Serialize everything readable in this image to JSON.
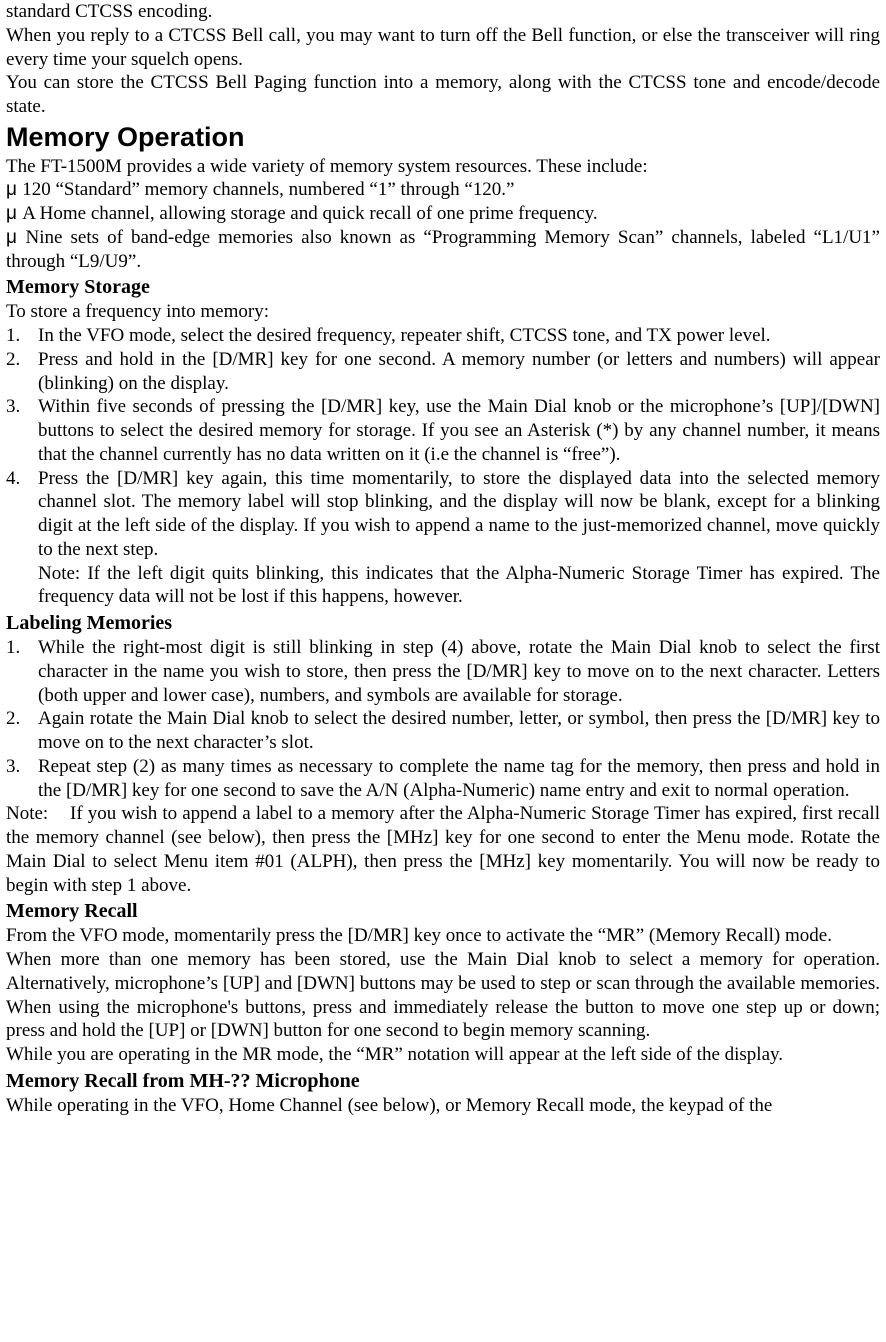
{
  "intro": {
    "p1": "standard CTCSS encoding.",
    "p2": "When you reply to a CTCSS Bell call, you may want to turn off the Bell function, or else the transceiver will ring every time your squelch opens.",
    "p3": "You can store the CTCSS Bell Paging function into a memory, along with the CTCSS tone and encode/decode state."
  },
  "memory_operation": {
    "heading": "Memory Operation",
    "intro": "The FT-1500M provides a wide variety of memory system resources. These include:",
    "bullets": {
      "b1": "120 “Standard” memory channels, numbered “1” through “120.”",
      "b2": "A Home channel, allowing storage and quick recall of one prime frequency.",
      "b3": "Nine sets of band-edge memories also known as “Programming Memory Scan” channels, labeled “L1/U1” through “L9/U9”."
    }
  },
  "memory_storage": {
    "heading": "Memory Storage",
    "intro": "To store a frequency into memory:",
    "items": {
      "i1": "In the VFO mode, select the desired frequency, repeater shift, CTCSS tone, and TX power level.",
      "i2": "Press and hold in the [D/MR] key for one second. A memory number (or letters and numbers) will appear (blinking) on the display.",
      "i3": "Within five seconds of pressing the [D/MR] key, use the Main Dial knob or the microphone’s [UP]/[DWN] buttons to select the desired memory for storage. If you see an Asterisk (*) by any channel number, it means that the channel currently has no data written on it (i.e the channel is “free”).",
      "i4": "Press the [D/MR] key again, this time momentarily, to store the displayed data into the selected memory channel slot. The memory label will stop blinking, and the display will now be blank, except for a blinking digit at the left side of the display. If you wish to append a name to the just-memorized channel, move quickly to the next step.",
      "note": "Note: If the left digit quits blinking, this indicates that the Alpha-Numeric Storage Timer has expired. The frequency data will not be lost if this happens, however."
    }
  },
  "labeling_memories": {
    "heading": "Labeling Memories",
    "items": {
      "i1": "While the right-most digit is still blinking in step (4) above, rotate the Main Dial knob to select the first character in the name you wish to store, then press the [D/MR] key to move on to the next character. Letters (both upper and lower case), numbers, and symbols are available for storage.",
      "i2": "Again rotate the Main Dial knob to select the desired number, letter, or symbol, then press the [D/MR] key to move on to the next character’s slot.",
      "i3": "Repeat step (2) as many times as necessary to complete the name tag for the memory, then press and hold in the [D/MR] key for one second to save the A/N (Alpha-Numeric) name entry and exit to normal operation."
    },
    "note_label": "Note:",
    "note": "If you wish to append a label to a memory after the Alpha-Numeric Storage Timer has expired, first recall the memory channel (see below), then press the [MHz] key for one second to enter the Menu mode. Rotate the Main Dial to select Menu item #01 (ALPH), then press the [MHz] key momentarily. You will now be ready to begin with step 1 above."
  },
  "memory_recall": {
    "heading": "Memory Recall",
    "p1": "From the VFO mode, momentarily press the [D/MR] key once to activate the “MR” (Memory Recall) mode.",
    "p2": "When more than one memory has been stored, use the Main Dial knob to select a memory for operation. Alternatively, microphone’s [UP] and [DWN] buttons may be used to step or scan through the available memories. When using the microphone's buttons, press and immediately release the button to move one step up or down; press and hold the [UP] or [DWN] button for one second to begin memory scanning.",
    "p3": "While you are operating in the MR mode, the “MR” notation will appear at the left side of the display."
  },
  "memory_recall_mh": {
    "heading": "Memory Recall from MH-?? Microphone",
    "p1": "While operating in the VFO, Home Channel (see below), or Memory Recall mode, the keypad of the"
  },
  "mu_char": "μ "
}
